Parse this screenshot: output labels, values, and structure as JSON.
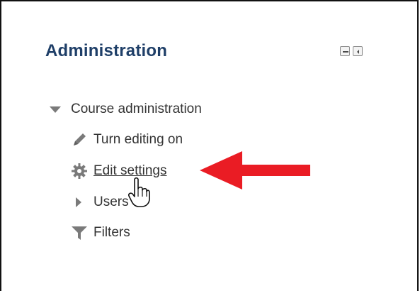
{
  "block": {
    "title": "Administration",
    "controls": [
      {
        "name": "minimize-block-button",
        "icon": "minus-icon"
      },
      {
        "name": "dock-block-button",
        "icon": "chevron-left-icon"
      }
    ]
  },
  "tree": {
    "course_administration": {
      "label": "Course administration",
      "icon": "triangle-down-icon"
    },
    "items": [
      {
        "label": "Turn editing on",
        "icon": "pencil-icon"
      },
      {
        "label": "Edit settings",
        "icon": "gear-icon"
      },
      {
        "label": "Users",
        "icon": "triangle-right-icon"
      },
      {
        "label": "Filters",
        "icon": "filter-icon"
      }
    ]
  },
  "annotations": {
    "arrow_color": "#ea1c24",
    "cursor": "hand-pointer-icon"
  },
  "colors": {
    "title": "#1f3f68",
    "text": "#333333",
    "icon_gray": "#7a7a7a"
  }
}
